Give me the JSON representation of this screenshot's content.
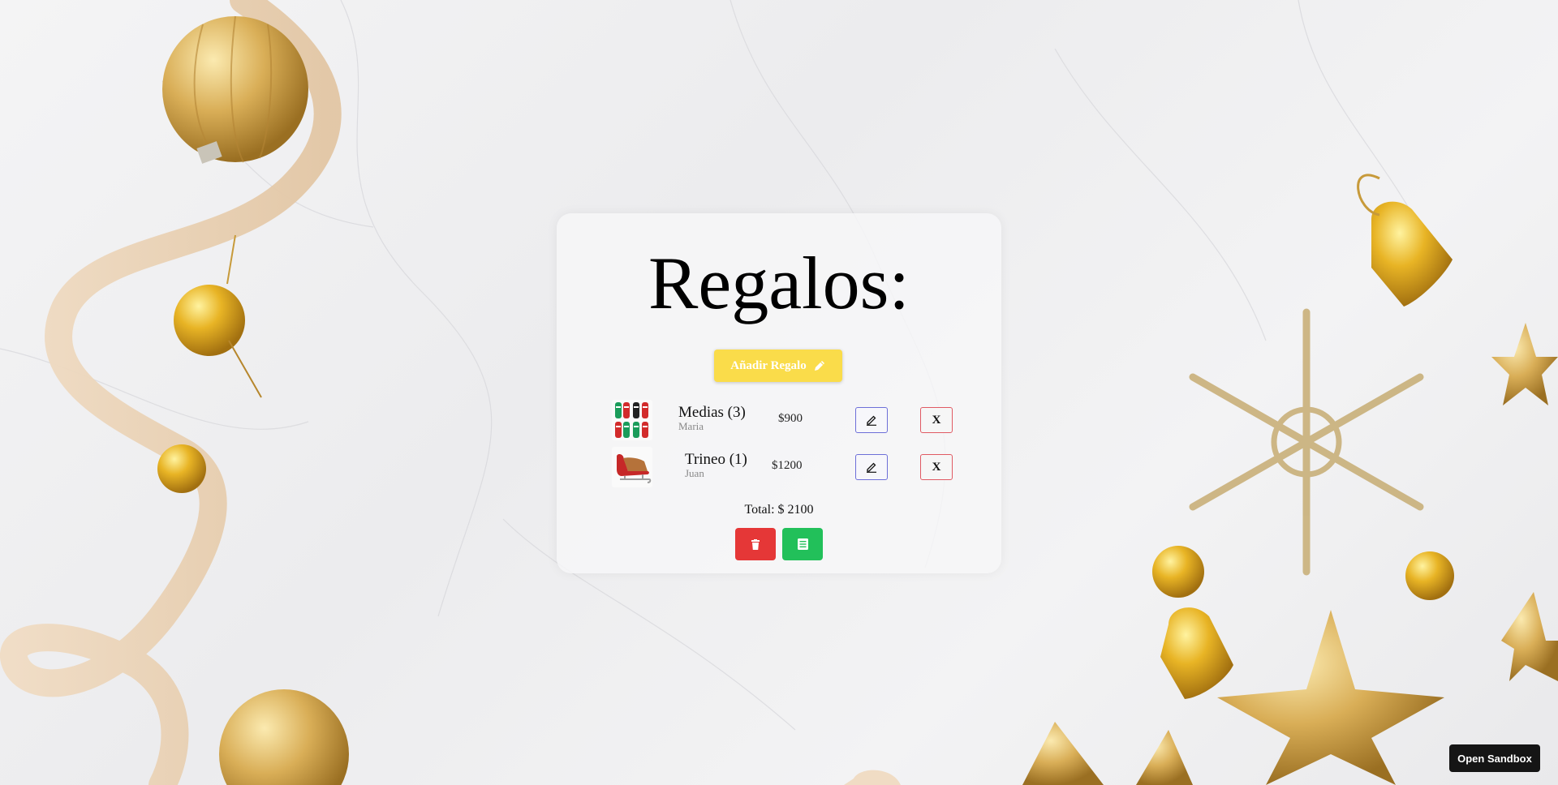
{
  "page": {
    "title": "Regalos:",
    "add_button_label": "Añadir Regalo",
    "add_button_icon": "pencil-icon"
  },
  "gifts": [
    {
      "name": "Medias (3)",
      "recipient": "Maria",
      "price": "$900",
      "image": "socks-image",
      "delete_label": "X"
    },
    {
      "name": "Trineo (1)",
      "recipient": "Juan",
      "price": "$1200",
      "image": "sleigh-image",
      "delete_label": "X"
    }
  ],
  "footer": {
    "total_text": "Total: $ 2100",
    "clear_icon": "trash-icon",
    "list_icon": "list-icon"
  },
  "sandbox_button": "Open Sandbox",
  "colors": {
    "add_button": "#fadc4a",
    "edit_border": "#6d6fd8",
    "delete_border": "#e05a63",
    "clear_button": "#e53737",
    "list_button": "#22c05a"
  }
}
